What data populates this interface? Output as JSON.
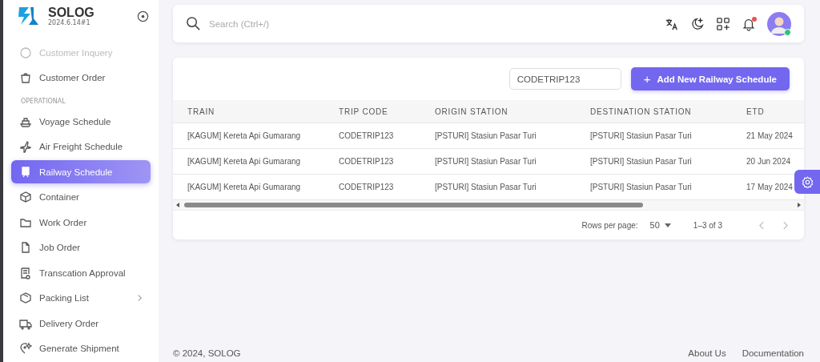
{
  "brand": {
    "name": "SOLOG",
    "version": "2024.6.14#1"
  },
  "sidebar": {
    "items": [
      {
        "kind": "item",
        "label": "Customer Inquery",
        "disabled": true,
        "selected": false,
        "expandable": false
      },
      {
        "kind": "item",
        "label": "Customer Order",
        "disabled": false,
        "selected": false,
        "expandable": false
      },
      {
        "kind": "header",
        "label": "OPERATIONAL"
      },
      {
        "kind": "item",
        "label": "Voyage Schedule",
        "disabled": false,
        "selected": false,
        "expandable": false
      },
      {
        "kind": "item",
        "label": "Air Freight Schedule",
        "disabled": false,
        "selected": false,
        "expandable": false
      },
      {
        "kind": "item",
        "label": "Railway Schedule",
        "disabled": false,
        "selected": true,
        "expandable": false
      },
      {
        "kind": "item",
        "label": "Container",
        "disabled": false,
        "selected": false,
        "expandable": false
      },
      {
        "kind": "item",
        "label": "Work Order",
        "disabled": false,
        "selected": false,
        "expandable": false
      },
      {
        "kind": "item",
        "label": "Job Order",
        "disabled": false,
        "selected": false,
        "expandable": false
      },
      {
        "kind": "item",
        "label": "Transcation Approval",
        "disabled": false,
        "selected": false,
        "expandable": false
      },
      {
        "kind": "item",
        "label": "Packing List",
        "disabled": false,
        "selected": false,
        "expandable": true
      },
      {
        "kind": "item",
        "label": "Delivery Order",
        "disabled": false,
        "selected": false,
        "expandable": false
      },
      {
        "kind": "item",
        "label": "Generate Shipment",
        "disabled": false,
        "selected": false,
        "expandable": false
      }
    ]
  },
  "search": {
    "placeholder": "Search (Ctrl+/)"
  },
  "notifications": {
    "unread": true
  },
  "user": {
    "online": true
  },
  "filter": {
    "value": "CODETRIP123"
  },
  "add_button": {
    "icon": "+",
    "label": "Add New Railway Schedule"
  },
  "table": {
    "columns": [
      "TRAIN",
      "TRIP CODE",
      "ORIGIN STATION",
      "DESTINATION STATION",
      "ETD"
    ],
    "rows": [
      [
        "[KAGUM] Kereta Api Gumarang",
        "CODETRIP123",
        "[PSTURI] Stasiun Pasar Turi",
        "[PSTURI] Stasiun Pasar Turi",
        "21 May 2024"
      ],
      [
        "[KAGUM] Kereta Api Gumarang",
        "CODETRIP123",
        "[PSTURI] Stasiun Pasar Turi",
        "[PSTURI] Stasiun Pasar Turi",
        "20 Jun 2024"
      ],
      [
        "[KAGUM] Kereta Api Gumarang",
        "CODETRIP123",
        "[PSTURI] Stasiun Pasar Turi",
        "[PSTURI] Stasiun Pasar Turi",
        "17 May 2024"
      ]
    ]
  },
  "pagination": {
    "rows_per_page_label": "Rows per page:",
    "rows_per_page": "50",
    "range": "1–3 of 3"
  },
  "footer": {
    "copyright": "© 2024, SOLOG",
    "links": [
      "About Us",
      "Documentation"
    ]
  }
}
